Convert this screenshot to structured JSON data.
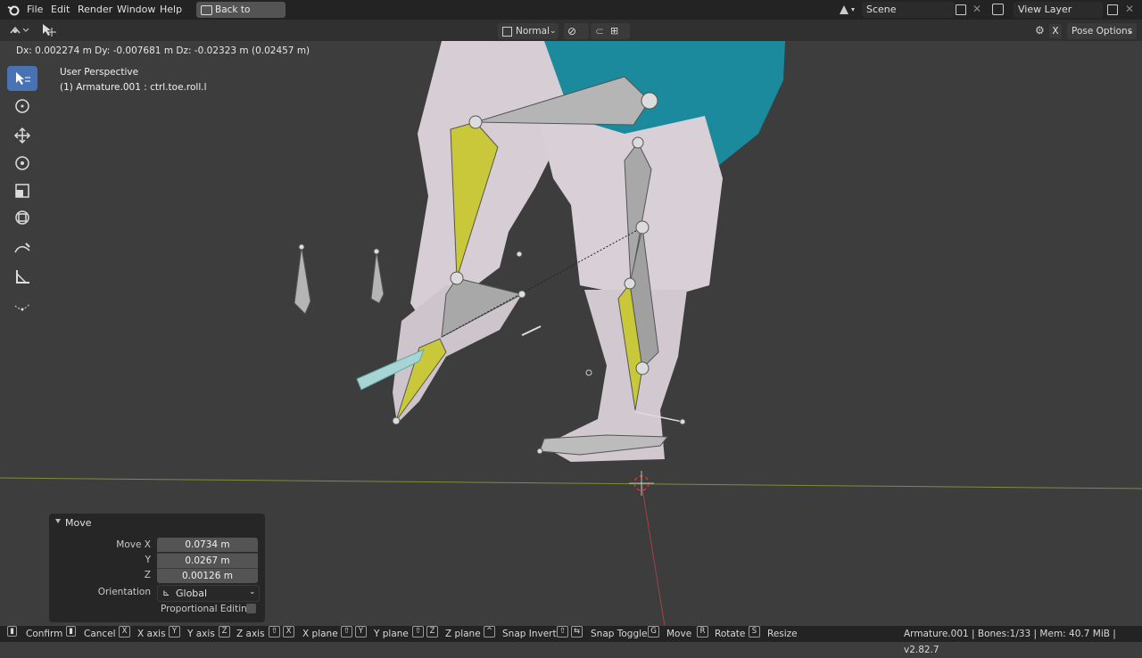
{
  "menu": {
    "file": "File",
    "edit": "Edit",
    "render": "Render",
    "window": "Window",
    "help": "Help",
    "back": "Back to Previous"
  },
  "scene": {
    "name": "Scene",
    "view_layer": "View Layer"
  },
  "header": {
    "pivot": "Normal",
    "pose_options": "Pose Options",
    "x_label": "X"
  },
  "hint": "Dx: 0.002274 m  Dy: -0.007681 m  Dz: -0.02323 m (0.02457 m)",
  "viewport": {
    "perspective": "User Perspective",
    "object": "(1) Armature.001 : ctrl.toe.roll.l"
  },
  "panel": {
    "title": "Move",
    "move_x_label": "Move X",
    "move_x": "0.0734 m",
    "y_label": "Y",
    "y": "0.0267 m",
    "z_label": "Z",
    "z": "0.00126 m",
    "orientation_label": "Orientation",
    "orientation": "Global",
    "proportional": "Proportional Editing"
  },
  "status": {
    "confirm": "Confirm",
    "cancel": "Cancel",
    "x_axis": "X axis",
    "y_axis": "Y axis",
    "z_axis": "Z axis",
    "x_plane": "X plane",
    "y_plane": "Y plane",
    "z_plane": "Z plane",
    "snap_invert": "Snap Invert",
    "snap_toggle": "Snap Toggle",
    "move": "Move",
    "rotate": "Rotate",
    "resize": "Resize",
    "info": "Armature.001 | Bones:1/33 | Mem: 40.7 MiB | v2.82.7",
    "k_x": "X",
    "k_y": "Y",
    "k_z": "Z",
    "k_g": "G",
    "k_r": "R",
    "k_s": "S"
  },
  "colors": {
    "accent": "#4772b3",
    "bone_selected": "#c8c83a",
    "mesh": "#d7cdd4",
    "shirt": "#1a8a9c"
  }
}
